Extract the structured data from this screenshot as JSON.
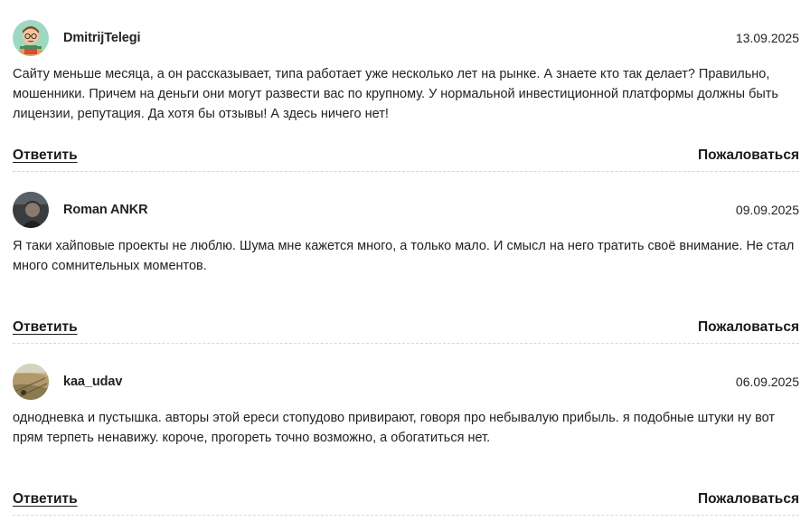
{
  "comments": [
    {
      "author": "DmitrijTelegi",
      "date": "13.09.2025",
      "text": "Сайту меньше месяца, а он рассказывает, типа работает уже несколько лет на рынке. А знаете кто так делает? Правильно, мошенники. Причем на деньги они могут развести вас по крупному. У нормальной инвестиционной платформы должны быть лицензии, репутация. Да хотя бы отзывы! А здесь ничего нет!",
      "reply_label": "Ответить",
      "report_label": "Пожаловаться",
      "avatar_icon": "cartoon-man-avatar"
    },
    {
      "author": "Roman ANKR",
      "date": "09.09.2025",
      "text": "Я таки хайповые проекты не люблю. Шума мне кажется много, а только мало. И смысл на него тратить своё внимание. Не стал много сомнительных моментов.",
      "reply_label": "Ответить",
      "report_label": "Пожаловаться",
      "avatar_icon": "dark-photo-avatar"
    },
    {
      "author": "kaa_udav",
      "date": "06.09.2025",
      "text": "однодневка и пустышка. авторы этой ереси стопудово привирают, говоря про небывалую прибыль. я подобные штуки ну вот прям терпеть ненавижу. короче, прогореть точно возможно, а обогатиться нет.",
      "reply_label": "Ответить",
      "report_label": "Пожаловаться",
      "avatar_icon": "landscape-photo-avatar"
    }
  ]
}
